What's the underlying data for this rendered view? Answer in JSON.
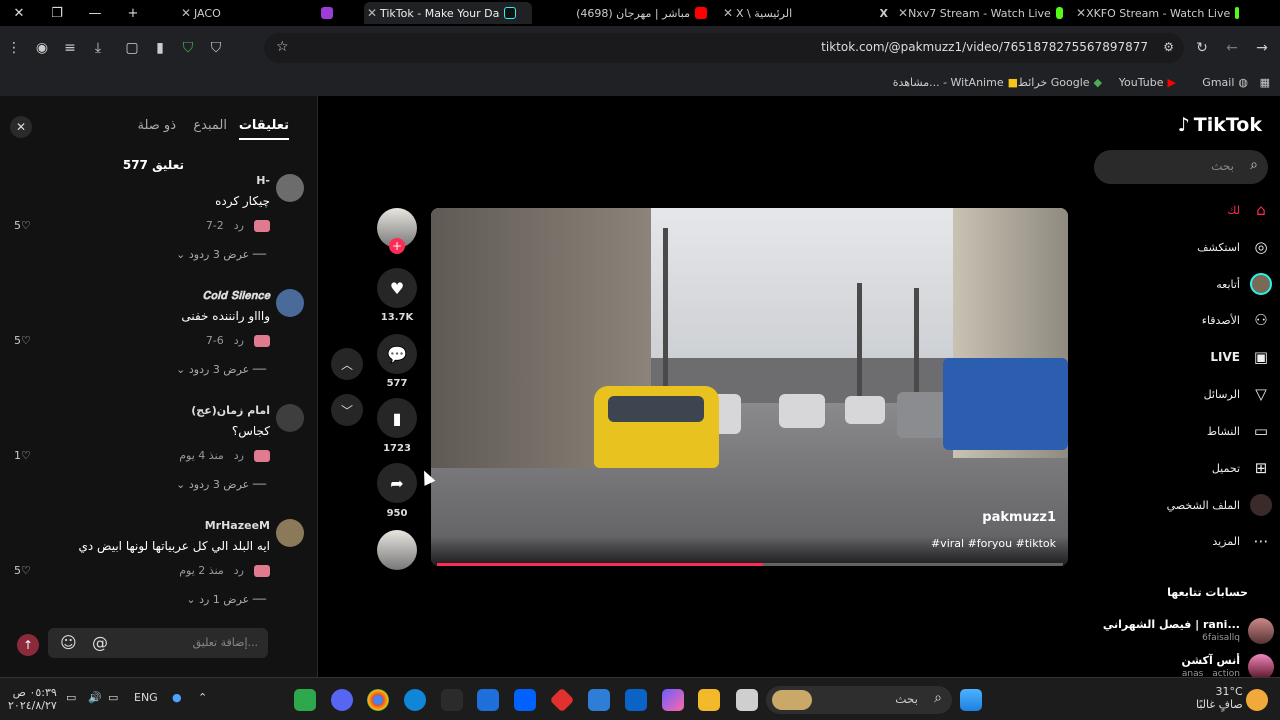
{
  "tabs": [
    {
      "title": "JACO",
      "color": "#f0f0f0"
    },
    {
      "title": "TikTok - Make Your Da",
      "color": "#25f4ee",
      "active": true
    },
    {
      "title": "مباشر | مهرجان (4698)",
      "color": "#ff0000"
    },
    {
      "title": "X \\ الرئيسية",
      "color": "#ffffff"
    },
    {
      "title": "Nxv7 Stream - Watch Live",
      "color": "#53fc18"
    },
    {
      "title": "XKFO Stream - Watch Live",
      "color": "#53fc18"
    }
  ],
  "address": {
    "url": "tiktok.com/@pakmuzz1/video/7651878275567897877"
  },
  "bookmarks": [
    "Gmail",
    "YouTube",
    "خرائط Google",
    "مشاهدة... - WitAnime"
  ],
  "comments_panel": {
    "tabs": [
      "تعليقات",
      "المبدع",
      "ذو صلة"
    ],
    "count": "577 تعليق",
    "comments": [
      {
        "user": "H-",
        "text": "چیکار کرده",
        "date": "7-2",
        "reply": "رد",
        "likes": "5",
        "replies": "عرض 3 ردود",
        "avatar": "#6c6c6c"
      },
      {
        "user": "𝐂𝐨𝐥𝐝 𝐒𝐢𝐥𝐞𝐧𝐜𝐞",
        "text": "واااو رانننده خفنی",
        "date": "7-6",
        "reply": "رد",
        "likes": "5",
        "replies": "عرض 3 ردود",
        "avatar": "#4a6a9a"
      },
      {
        "user": "امام زمان(عج)",
        "text": "کجاس؟",
        "date": "منذ 4 يوم",
        "reply": "رد",
        "likes": "1",
        "replies": "عرض 3 ردود",
        "avatar": "#3e3e3e"
      },
      {
        "user": "MrHazeeM",
        "text": "ايه البلد الي كل عربياتها لونها ابيض دي",
        "date": "منذ 2 يوم",
        "reply": "رد",
        "likes": "5",
        "replies": "عرض 1 رد",
        "avatar": "#8a7a5a"
      }
    ],
    "add_placeholder": "إضافة تعليق..."
  },
  "video": {
    "username": "pakmuzz1",
    "tags": "#viral #foryou #tiktok",
    "progress": 0.52
  },
  "actions": {
    "likes": "13.7K",
    "comments": "577",
    "saves": "1723",
    "shares": "950"
  },
  "sidebar": {
    "logo": "TikTok",
    "search_placeholder": "بحث",
    "items": [
      {
        "label": "لك",
        "icon": "home-icon"
      },
      {
        "label": "استكشف",
        "icon": "compass-icon"
      },
      {
        "label": "أتابعه",
        "icon": "following-avatar-icon"
      },
      {
        "label": "الأصدقاء",
        "icon": "friends-icon"
      },
      {
        "label": "LIVE",
        "icon": "live-icon"
      },
      {
        "label": "الرسائل",
        "icon": "messages-icon"
      },
      {
        "label": "النشاط",
        "icon": "activity-icon"
      },
      {
        "label": "تحميل",
        "icon": "upload-icon"
      },
      {
        "label": "الملف الشخصي",
        "icon": "profile-icon"
      },
      {
        "label": "المزيد",
        "icon": "more-icon"
      }
    ],
    "following_title": "حسابات تتابعها",
    "following": [
      {
        "name": "فيصل الشهراني | rani...",
        "handle": "6faisallq"
      },
      {
        "name": "أنس آكشن",
        "handle": "anas__action"
      }
    ]
  },
  "taskbar": {
    "search": "بحث",
    "weather_temp": "31°C",
    "weather_text": "صافٍ غالبًا",
    "lang": "ENG",
    "time": "٠٥:٣٩ ص",
    "date": "٢٠٢٤/٨/٢٧"
  }
}
